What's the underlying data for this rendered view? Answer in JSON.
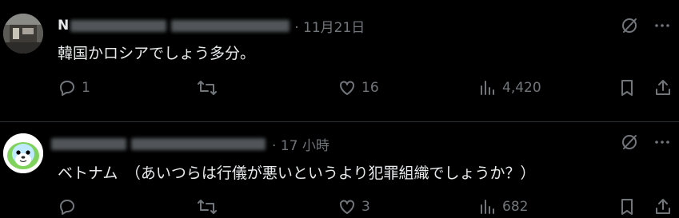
{
  "posts": [
    {
      "display_name": "N",
      "timestamp": "· 11月21日",
      "text": "韓国かロシアでしょう多分。",
      "stats": {
        "replies": "1",
        "reposts": "",
        "likes": "16",
        "views": "4,420"
      },
      "avatar_icon": "photo-avatar"
    },
    {
      "display_name": "",
      "timestamp": "· 17 小時",
      "text": "ベトナム　（あいつらは行儀が悪いというより犯罪組織でしょうか？）",
      "stats": {
        "replies": "",
        "reposts": "",
        "likes": "3",
        "views": "682"
      },
      "avatar_icon": "cartoon-otter-avatar"
    }
  ],
  "icons": {
    "grok": "grok-icon",
    "more": "more-icon",
    "reply": "reply-icon",
    "repost": "repost-icon",
    "like": "heart-icon",
    "views": "views-icon",
    "bookmark": "bookmark-icon",
    "share": "share-icon"
  },
  "colors": {
    "background": "#000000",
    "text": "#e7e9ea",
    "muted": "#71767b",
    "divider": "#2f3336"
  }
}
